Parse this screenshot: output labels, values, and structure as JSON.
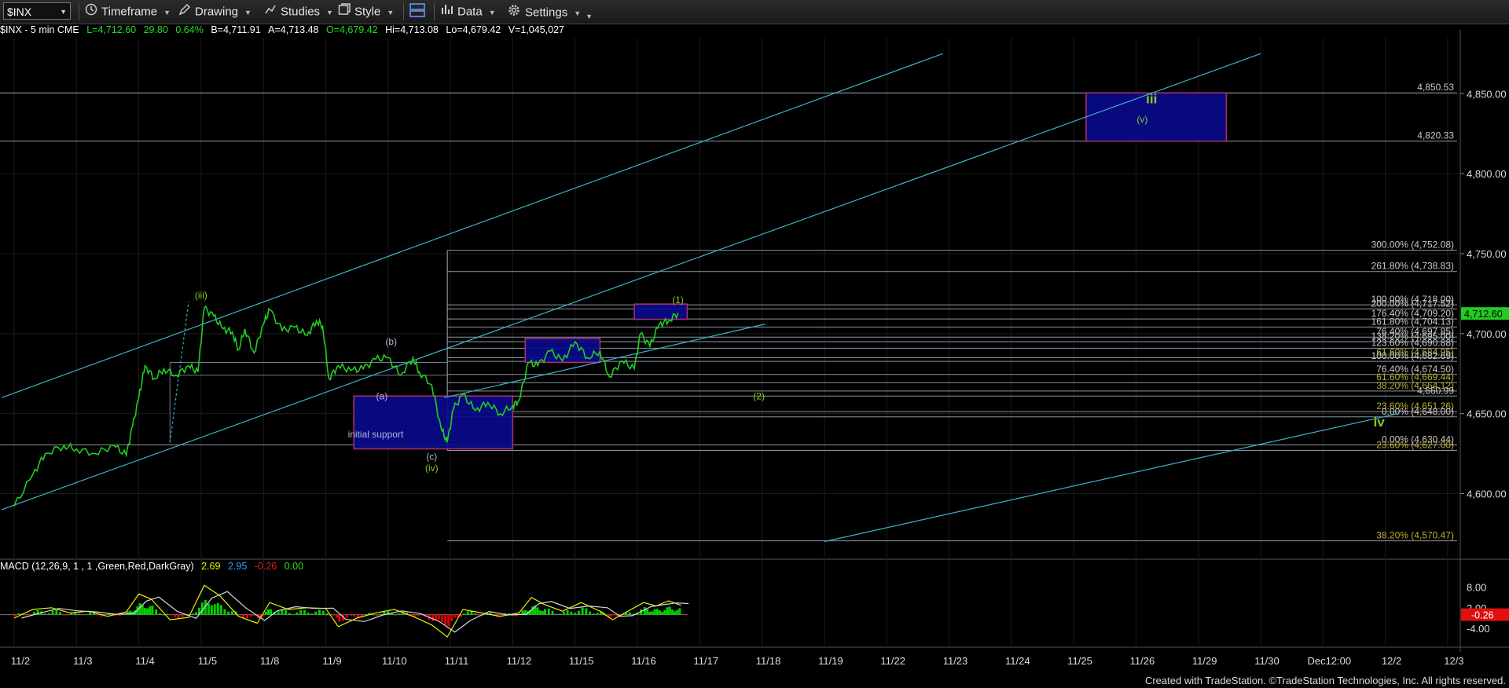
{
  "toolbar": {
    "symbol": "$INX",
    "timeframe": "Timeframe",
    "drawing": "Drawing",
    "studies": "Studies",
    "style": "Style",
    "data": "Data",
    "settings": "Settings"
  },
  "info": {
    "symbol_desc": "$INX - 5 min  CME",
    "last": "L=4,712.60",
    "change": "29.80",
    "pct": "0.64%",
    "bid": "B=4,711.91",
    "ask": "A=4,713.48",
    "open": "O=4,679.42",
    "high": "Hi=4,713.08",
    "low": "Lo=4,679.42",
    "volume": "V=1,045,027"
  },
  "macd_info": {
    "label": "MACD (12,26,9, 1 , 1 ,Green,Red,DarkGray)",
    "v1": "2.69",
    "v2": "2.95",
    "v3": "-0.26",
    "v4": "0.00"
  },
  "colors": {
    "price_line": "#22cc22",
    "grid": "#1e1e1e",
    "fib_line": "#a8b0c0",
    "channel": "#3fb0c8",
    "box_fill": "#0a0a8a",
    "box_border": "#b0306a",
    "label_green": "#88cc22",
    "label_blue": "#aab8d8",
    "last_price": "#22cc22",
    "macd_green": "#00d000",
    "macd_red": "#e00000",
    "macd_line": "#f0f000",
    "signal_line": "#d8d8d8"
  },
  "chart_data": {
    "type": "line",
    "title": "$INX - 5 min",
    "ylim": [
      4560,
      4885
    ],
    "x_ticks": [
      "11/2",
      "11/3",
      "11/4",
      "11/5",
      "11/8",
      "11/9",
      "11/10",
      "11/11",
      "11/12",
      "11/15",
      "11/16",
      "11/17",
      "11/18",
      "11/19",
      "11/22",
      "11/23",
      "11/24",
      "11/25",
      "11/26",
      "11/29",
      "11/30",
      "Dec12:00",
      "12/2",
      "12/3"
    ],
    "y_ticks": [
      {
        "value": 4600,
        "label": "4,600.00"
      },
      {
        "value": 4650,
        "label": "4,650.00"
      },
      {
        "value": 4700,
        "label": "4,700.00"
      },
      {
        "value": 4750,
        "label": "4,750.00"
      },
      {
        "value": 4800,
        "label": "4,800.00"
      },
      {
        "value": 4850,
        "label": "4,850.00"
      }
    ],
    "last_price": {
      "value": 4712.6,
      "label": "4,712.60"
    },
    "series": [
      {
        "name": "$INX",
        "points": [
          [
            0,
            4592
          ],
          [
            0.3,
            4612
          ],
          [
            0.5,
            4625
          ],
          [
            0.8,
            4630
          ],
          [
            1.0,
            4628
          ],
          [
            1.3,
            4625
          ],
          [
            1.6,
            4630
          ],
          [
            1.8,
            4624
          ],
          [
            1.9,
            4642
          ],
          [
            2.0,
            4660
          ],
          [
            2.1,
            4680
          ],
          [
            2.25,
            4672
          ],
          [
            2.4,
            4678
          ],
          [
            2.6,
            4674
          ],
          [
            2.8,
            4680
          ],
          [
            2.95,
            4676
          ],
          [
            3.05,
            4716
          ],
          [
            3.2,
            4711
          ],
          [
            3.35,
            4703
          ],
          [
            3.5,
            4701
          ],
          [
            3.6,
            4690
          ],
          [
            3.7,
            4703
          ],
          [
            3.85,
            4688
          ],
          [
            4.0,
            4706
          ],
          [
            4.1,
            4715
          ],
          [
            4.3,
            4702
          ],
          [
            4.5,
            4704
          ],
          [
            4.7,
            4699
          ],
          [
            4.85,
            4708
          ],
          [
            4.95,
            4705
          ],
          [
            5.05,
            4672
          ],
          [
            5.2,
            4680
          ],
          [
            5.4,
            4677
          ],
          [
            5.6,
            4678
          ],
          [
            5.8,
            4684
          ],
          [
            6.0,
            4685
          ],
          [
            6.2,
            4674
          ],
          [
            6.4,
            4685
          ],
          [
            6.5,
            4676
          ],
          [
            6.7,
            4668
          ],
          [
            6.85,
            4641
          ],
          [
            6.95,
            4632
          ],
          [
            7.05,
            4653
          ],
          [
            7.2,
            4662
          ],
          [
            7.4,
            4652
          ],
          [
            7.6,
            4657
          ],
          [
            7.8,
            4650
          ],
          [
            8.0,
            4655
          ],
          [
            8.1,
            4658
          ],
          [
            8.25,
            4682
          ],
          [
            8.4,
            4680
          ],
          [
            8.6,
            4689
          ],
          [
            8.8,
            4683
          ],
          [
            9.0,
            4695
          ],
          [
            9.2,
            4685
          ],
          [
            9.4,
            4689
          ],
          [
            9.55,
            4673
          ],
          [
            9.75,
            4683
          ],
          [
            9.95,
            4678
          ],
          [
            10.05,
            4700
          ],
          [
            10.2,
            4692
          ],
          [
            10.35,
            4706
          ],
          [
            10.5,
            4708
          ],
          [
            10.65,
            4713
          ]
        ]
      }
    ],
    "fib_levels": [
      {
        "value": 4850.53,
        "label": "4,850.53"
      },
      {
        "value": 4820.33,
        "label": "4,820.33"
      },
      {
        "value": 4752.08,
        "label": "300.00% (4,752.08)"
      },
      {
        "value": 4738.83,
        "label": "261.80% (4,738.83)"
      },
      {
        "value": 4718.0,
        "label": "100.00% (4,718.00)"
      },
      {
        "value": 4715.5,
        "label": "200.00% (4,717.52)"
      },
      {
        "value": 4709.2,
        "label": "176.40% (4,709.20)"
      },
      {
        "value": 4704.13,
        "label": "161.80% (4,704.13)"
      },
      {
        "value": 4697.85,
        "label": "76.40% (4,697.85)"
      },
      {
        "value": 4695.0,
        "label": "138.20% (4,695.00)"
      },
      {
        "value": 4690.88,
        "label": "123.60% (4,690.88)"
      },
      {
        "value": 4684.95,
        "label": "61.60% (4,684.95)"
      },
      {
        "value": 4682.69,
        "label": "100.00% (4,682.69)"
      },
      {
        "value": 4674.5,
        "label": "76.40% (4,674.50)"
      },
      {
        "value": 4669.44,
        "label": "61.60% (4,669.44)"
      },
      {
        "value": 4664.12,
        "label": "38.20% (4,664.12)"
      },
      {
        "value": 4660.99,
        "label": "4,660.99"
      },
      {
        "value": 4651.26,
        "label": "23.60% (4,651.26)"
      },
      {
        "value": 4648.0,
        "label": "0.00% (4,648.00)"
      },
      {
        "value": 4630.44,
        "label": "0.00% (4,630.44)"
      },
      {
        "value": 4627.0,
        "label": "23.60% (4,627.00)"
      },
      {
        "value": 4570.47,
        "label": "38.20% (4,570.47)"
      }
    ],
    "annotations": [
      {
        "text": "(iii)",
        "x": 3.0,
        "y": 4722,
        "color": "green"
      },
      {
        "text": "(b)",
        "x": 6.05,
        "y": 4693,
        "color": "blue"
      },
      {
        "text": "(a)",
        "x": 5.9,
        "y": 4659,
        "color": "blue"
      },
      {
        "text": "initial support",
        "x": 5.8,
        "y": 4635,
        "color": "blue"
      },
      {
        "text": "(c)",
        "x": 6.7,
        "y": 4621,
        "color": "blue"
      },
      {
        "text": "(iv)",
        "x": 6.7,
        "y": 4614,
        "color": "green"
      },
      {
        "text": "(1)",
        "x": 10.65,
        "y": 4719,
        "color": "green"
      },
      {
        "text": "(2)",
        "x": 11.95,
        "y": 4659,
        "color": "green"
      },
      {
        "text": "iii",
        "x": 18.25,
        "y": 4844,
        "color": "green"
      },
      {
        "text": "(v)",
        "x": 18.1,
        "y": 4832,
        "color": "green"
      },
      {
        "text": "iv",
        "x": 21.9,
        "y": 4642,
        "color": "green"
      }
    ],
    "boxes": [
      {
        "x0": 5.45,
        "x1": 8.0,
        "y0": 4628,
        "y1": 4661
      },
      {
        "x0": 8.2,
        "x1": 9.4,
        "y0": 4682,
        "y1": 4697
      },
      {
        "x0": 9.95,
        "x1": 10.8,
        "y0": 4709,
        "y1": 4718.5
      },
      {
        "x0": 17.2,
        "x1": 19.45,
        "y0": 4820.33,
        "y1": 4850.53
      }
    ],
    "macd": {
      "ylim": [
        -9,
        12
      ],
      "y_ticks": [
        {
          "value": 8,
          "label": "8.00"
        },
        {
          "value": 2,
          "label": "2.00"
        },
        {
          "value": 0,
          "label": "-0.26"
        },
        {
          "value": -4,
          "label": "-4.00"
        }
      ],
      "points": [
        [
          0,
          -1
        ],
        [
          0.3,
          1.5
        ],
        [
          0.6,
          2.0
        ],
        [
          0.9,
          0.5
        ],
        [
          1.2,
          1.0
        ],
        [
          1.5,
          -0.5
        ],
        [
          1.8,
          0.8
        ],
        [
          2.0,
          6.0
        ],
        [
          2.2,
          4.5
        ],
        [
          2.5,
          -1.5
        ],
        [
          2.8,
          -0.8
        ],
        [
          3.05,
          8.5
        ],
        [
          3.3,
          5.5
        ],
        [
          3.6,
          -0.5
        ],
        [
          3.9,
          -2.5
        ],
        [
          4.1,
          3.5
        ],
        [
          4.4,
          1.5
        ],
        [
          4.7,
          2.0
        ],
        [
          5.0,
          1.8
        ],
        [
          5.2,
          -3.5
        ],
        [
          5.5,
          -1.0
        ],
        [
          5.8,
          0.5
        ],
        [
          6.1,
          1.5
        ],
        [
          6.4,
          -0.5
        ],
        [
          6.7,
          -3.0
        ],
        [
          6.95,
          -6.5
        ],
        [
          7.2,
          1.5
        ],
        [
          7.5,
          0.5
        ],
        [
          7.8,
          -0.5
        ],
        [
          8.1,
          0.5
        ],
        [
          8.3,
          5.0
        ],
        [
          8.5,
          3.0
        ],
        [
          8.8,
          1.0
        ],
        [
          9.1,
          3.5
        ],
        [
          9.4,
          1.0
        ],
        [
          9.6,
          -1.5
        ],
        [
          9.8,
          0.5
        ],
        [
          10.1,
          3.5
        ],
        [
          10.3,
          2.5
        ],
        [
          10.5,
          4.0
        ],
        [
          10.7,
          2.7
        ]
      ]
    }
  },
  "footer": "Created with TradeStation. ©TradeStation Technologies, Inc. All rights reserved."
}
